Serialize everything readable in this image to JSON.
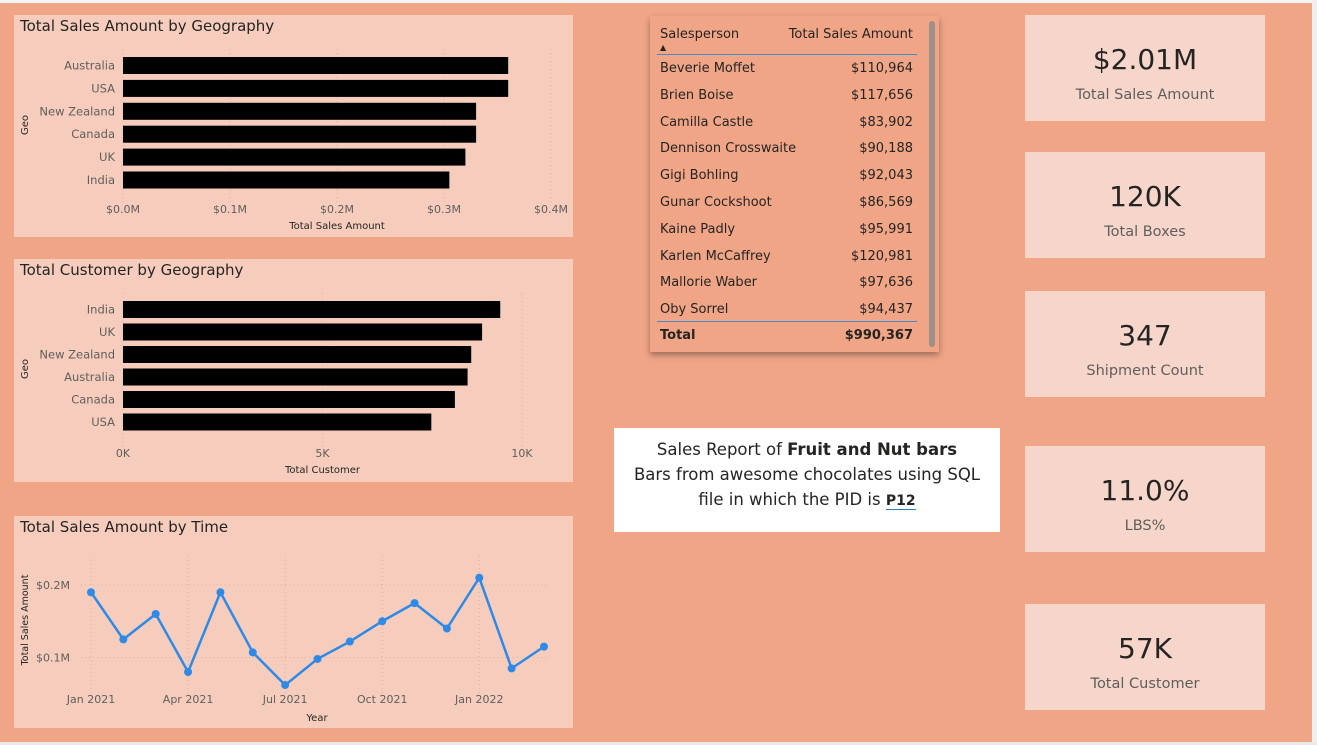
{
  "chart_data": [
    {
      "type": "bar",
      "title": "Total Sales Amount by Geography",
      "ylabel": "Geo",
      "xlabel": "Total Sales Amount",
      "categories": [
        "Australia",
        "USA",
        "New Zealand",
        "Canada",
        "UK",
        "India"
      ],
      "values": [
        0.36,
        0.36,
        0.33,
        0.33,
        0.32,
        0.305
      ],
      "unit": "$M",
      "xticks": [
        "$0.0M",
        "$0.1M",
        "$0.2M",
        "$0.3M",
        "$0.4M"
      ],
      "xlim": [
        0,
        0.4
      ],
      "bar_color": "#000000"
    },
    {
      "type": "bar",
      "title": "Total Customer by Geography",
      "ylabel": "Geo",
      "xlabel": "Total Customer",
      "categories": [
        "India",
        "UK",
        "New Zealand",
        "Australia",
        "Canada",
        "USA"
      ],
      "values": [
        10400,
        9900,
        9600,
        9500,
        9150,
        8500
      ],
      "xticks": [
        "0K",
        "5K",
        "10K"
      ],
      "xlim": [
        0,
        11000
      ],
      "bar_color": "#000000"
    },
    {
      "type": "line",
      "title": "Total Sales Amount by Time",
      "ylabel": "Total Sales Amount",
      "xlabel": "Year",
      "x": [
        "2021-01",
        "2021-02",
        "2021-03",
        "2021-04",
        "2021-05",
        "2021-06",
        "2021-07",
        "2021-08",
        "2021-09",
        "2021-10",
        "2021-11",
        "2021-12",
        "2022-01",
        "2022-02",
        "2022-03"
      ],
      "values": [
        0.19,
        0.125,
        0.16,
        0.08,
        0.19,
        0.107,
        0.062,
        0.098,
        0.122,
        0.15,
        0.175,
        0.14,
        0.21,
        0.085,
        0.115
      ],
      "unit": "$M",
      "xticks": [
        "Jan 2021",
        "Apr 2021",
        "Jul 2021",
        "Oct 2021",
        "Jan 2022"
      ],
      "yticks": [
        "$0.1M",
        "$0.2M"
      ],
      "ylim": [
        0.04,
        0.24
      ],
      "line_color": "#2e8ae6"
    }
  ],
  "table": {
    "col1": "Salesperson",
    "col2": "Total Sales Amount",
    "rows": [
      {
        "name": "Beverie Moffet",
        "amount": "$110,964"
      },
      {
        "name": "Brien Boise",
        "amount": "$117,656"
      },
      {
        "name": "Camilla Castle",
        "amount": "$83,902"
      },
      {
        "name": "Dennison Crosswaite",
        "amount": "$90,188"
      },
      {
        "name": "Gigi Bohling",
        "amount": "$92,043"
      },
      {
        "name": "Gunar Cockshoot",
        "amount": "$86,569"
      },
      {
        "name": "Kaine Padly",
        "amount": "$95,991"
      },
      {
        "name": "Karlen McCaffrey",
        "amount": "$120,981"
      },
      {
        "name": "Mallorie Waber",
        "amount": "$97,636"
      },
      {
        "name": "Oby Sorrel",
        "amount": "$94,437"
      }
    ],
    "total_label": "Total",
    "total_value": "$990,367"
  },
  "textbox": {
    "line1_prefix": "Sales Report of ",
    "line1_bold": "Fruit and Nut bars",
    "line2": "Bars from awesome chocolates using SQL",
    "line3_prefix": "file in which the PID is ",
    "pid": "P12"
  },
  "kpis": [
    {
      "value": "$2.01M",
      "label": "Total Sales Amount"
    },
    {
      "value": "120K",
      "label": "Total Boxes"
    },
    {
      "value": "347",
      "label": "Shipment Count"
    },
    {
      "value": "11.0%",
      "label": "LBS%"
    },
    {
      "value": "57K",
      "label": "Total Customer"
    }
  ]
}
